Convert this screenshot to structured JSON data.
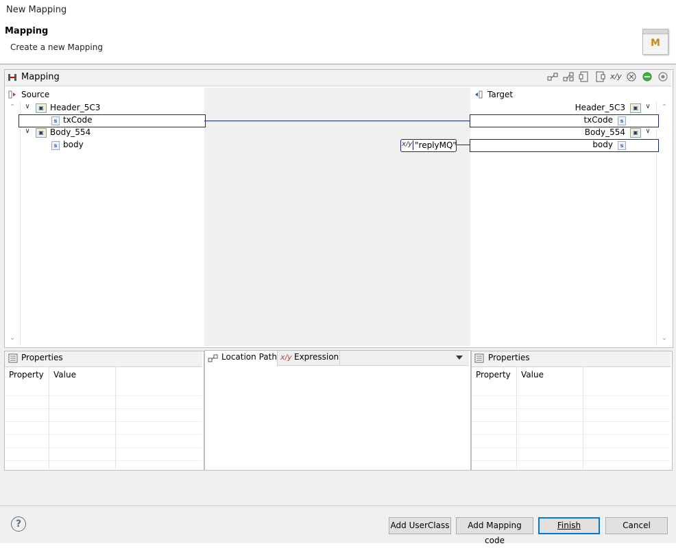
{
  "window": {
    "title": "New Mapping"
  },
  "header": {
    "title": "Mapping",
    "description": "Create a new Mapping",
    "logo_letter": "M"
  },
  "mapping_panel": {
    "title": "Mapping",
    "toolbar_icons": [
      "link-icon",
      "link-multi-icon",
      "expand-icon",
      "collapse-icon",
      "expression-icon",
      "clear-icon",
      "green-dot-icon",
      "settings-icon"
    ]
  },
  "source": {
    "label": "Source",
    "nodes": [
      {
        "label": "Header_5C3",
        "type": "group",
        "expanded": true
      },
      {
        "label": "txCode",
        "type": "string",
        "selected": true
      },
      {
        "label": "Body_554",
        "type": "group",
        "expanded": true
      },
      {
        "label": "body",
        "type": "string"
      }
    ]
  },
  "target": {
    "label": "Target",
    "nodes": [
      {
        "label": "Header_5C3",
        "type": "group",
        "expanded": true
      },
      {
        "label": "txCode",
        "type": "string",
        "selected": true
      },
      {
        "label": "Body_554",
        "type": "group",
        "expanded": true
      },
      {
        "label": "body",
        "type": "string",
        "selected": true
      }
    ]
  },
  "expression_node": {
    "label": "\"replyMQ\""
  },
  "string_badge": "s",
  "left_properties": {
    "title": "Properties",
    "columns": [
      "Property",
      "Value"
    ]
  },
  "center_tabs": {
    "location_path": "Location Path",
    "expression": "Expression"
  },
  "right_properties": {
    "title": "Properties",
    "columns": [
      "Property",
      "Value"
    ]
  },
  "footer": {
    "help": "?",
    "add_userclass": "Add UserClass",
    "add_mapping_code": "Add Mapping code",
    "finish": "Finish",
    "cancel": "Cancel"
  },
  "colors": {
    "accent": "#1a237e",
    "panel_bg": "#f0f0f0",
    "status_green": "#3cb043"
  }
}
